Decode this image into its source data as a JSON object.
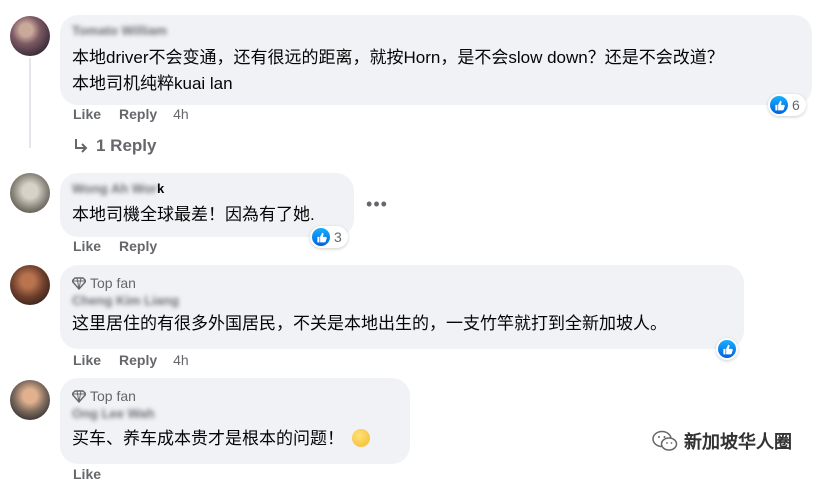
{
  "comments": [
    {
      "author": "Tomato William",
      "badge": "",
      "text": "本地driver不会变通，还有很远的距离，就按Horn，是不会slow down？还是不会改道？\n本地司机纯粹kuai lan",
      "reactions": "6",
      "like": "Like",
      "reply": "Reply",
      "time": "4h"
    },
    {
      "author_blurred": "Wong Ah Wor",
      "author_clear": "k",
      "badge": "",
      "text": "本地司機全球最差！因為有了她.",
      "reactions": "3",
      "like": "Like",
      "reply": "Reply",
      "time": ""
    },
    {
      "author": "Cheng Kim Liang",
      "badge": "Top fan",
      "text": "这里居住的有很多外国居民，不关是本地出生的，一支竹竿就打到全新加坡人。",
      "reactions": "",
      "like": "Like",
      "reply": "Reply",
      "time": "4h"
    },
    {
      "author": "Ong Lee Wah",
      "badge": "Top fan",
      "text": "买车、养车成本贵才是根本的问题！",
      "reactions": "",
      "like": "Like",
      "reply": "",
      "time": ""
    }
  ],
  "replies_link": "1 Reply",
  "watermark": "新加坡华人圈",
  "icons": {
    "like": "thumbs-up-icon",
    "top_fan": "diamond-badge-icon",
    "reply_arrow": "reply-arrow-icon",
    "more": "more-options-icon",
    "emoji": "laughing-sweat-emoji-icon",
    "watermark": "wechat-logo-icon"
  },
  "colors": {
    "bubble": "#f0f2f5",
    "meta_text": "#65676b",
    "like_blue": "#0866ff"
  }
}
